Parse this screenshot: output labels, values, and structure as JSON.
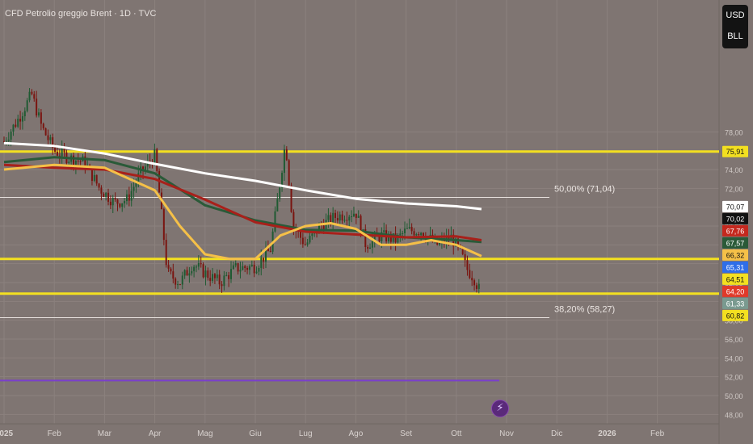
{
  "header": {
    "symbol_title": "CFD Petrolio greggio Brent · 1D · TVC"
  },
  "currency": {
    "top": "USD",
    "bottom": "BLL"
  },
  "event_icon": "lightning-icon",
  "chart_data": {
    "type": "candlestick",
    "title": "CFD Petrolio greggio Brent · 1D · TVC",
    "ylim": [
      47,
      92
    ],
    "y_ticks": [
      "48,00",
      "50,00",
      "52,00",
      "54,00",
      "56,00",
      "58,00",
      "60,00",
      "62,00",
      "64,00",
      "66,00",
      "68,00",
      "70,00",
      "72,00",
      "74,00",
      "76,00",
      "78,00"
    ],
    "x_labels": [
      "2025",
      "Feb",
      "Mar",
      "Apr",
      "Mag",
      "Giu",
      "Lug",
      "Ago",
      "Set",
      "Ott",
      "Nov",
      "Dic",
      "2026",
      "Feb"
    ],
    "x_months": [
      0,
      1,
      2,
      3,
      4,
      5,
      6,
      7,
      8,
      9,
      10,
      11,
      12,
      13
    ],
    "close_path": [
      [
        0,
        77
      ],
      [
        0.3,
        79.5
      ],
      [
        0.55,
        82
      ],
      [
        0.75,
        78.5
      ],
      [
        1,
        76
      ],
      [
        1.3,
        75.2
      ],
      [
        1.6,
        74.8
      ],
      [
        1.9,
        72
      ],
      [
        2.2,
        70.5
      ],
      [
        2.45,
        70.8
      ],
      [
        2.7,
        73.5
      ],
      [
        3,
        75.5
      ],
      [
        3.1,
        71
      ],
      [
        3.25,
        63
      ],
      [
        3.5,
        62
      ],
      [
        3.75,
        64
      ],
      [
        4,
        63
      ],
      [
        4.3,
        62
      ],
      [
        4.6,
        63.5
      ],
      [
        5,
        63.7
      ],
      [
        5.3,
        65.5
      ],
      [
        5.45,
        71
      ],
      [
        5.6,
        77
      ],
      [
        5.75,
        68
      ],
      [
        6,
        66
      ],
      [
        6.3,
        68
      ],
      [
        6.6,
        69
      ],
      [
        7,
        69.5
      ],
      [
        7.2,
        66
      ],
      [
        7.5,
        67
      ],
      [
        7.8,
        66.5
      ],
      [
        8,
        67.5
      ],
      [
        8.3,
        67.5
      ],
      [
        8.6,
        66
      ],
      [
        8.9,
        66.8
      ],
      [
        9.1,
        65
      ],
      [
        9.2,
        63.5
      ],
      [
        9.35,
        62.5
      ],
      [
        9.45,
        61.3
      ]
    ],
    "series": [
      {
        "color": "#ffffff",
        "points": [
          [
            0,
            76.8
          ],
          [
            1,
            76.5
          ],
          [
            2,
            75.7
          ],
          [
            3,
            74.6
          ],
          [
            4,
            73.6
          ],
          [
            5,
            72.8
          ],
          [
            6,
            71.8
          ],
          [
            7,
            70.9
          ],
          [
            8,
            70.4
          ],
          [
            9,
            70.1
          ],
          [
            9.5,
            69.8
          ]
        ]
      },
      {
        "color": "#2a5a38",
        "points": [
          [
            0,
            74.8
          ],
          [
            1,
            75.3
          ],
          [
            2,
            75
          ],
          [
            3,
            73.6
          ],
          [
            4,
            70.2
          ],
          [
            5,
            68.6
          ],
          [
            6,
            67.6
          ],
          [
            7,
            67.5
          ],
          [
            8,
            66.8
          ],
          [
            9,
            66.5
          ],
          [
            9.5,
            66.3
          ]
        ]
      },
      {
        "color": "#a8201a",
        "points": [
          [
            0,
            74.5
          ],
          [
            1,
            74.2
          ],
          [
            2,
            74
          ],
          [
            3,
            73
          ],
          [
            4,
            70.8
          ],
          [
            5,
            68.4
          ],
          [
            6,
            67.4
          ],
          [
            7,
            67.1
          ],
          [
            8,
            66.8
          ],
          [
            9,
            66.9
          ],
          [
            9.5,
            66.5
          ]
        ]
      },
      {
        "color": "#f5c048",
        "points": [
          [
            0,
            74
          ],
          [
            1,
            74.5
          ],
          [
            2,
            74.2
          ],
          [
            3,
            71.8
          ],
          [
            3.5,
            68
          ],
          [
            4,
            65
          ],
          [
            4.5,
            64.5
          ],
          [
            5,
            64.5
          ],
          [
            5.5,
            67
          ],
          [
            6,
            68
          ],
          [
            6.5,
            68.3
          ],
          [
            7,
            67.7
          ],
          [
            7.5,
            66
          ],
          [
            8,
            66
          ],
          [
            8.5,
            66.5
          ],
          [
            9,
            66
          ],
          [
            9.5,
            64.8
          ]
        ]
      }
    ],
    "horizontal_levels": [
      {
        "value": 75.91,
        "color": "#f3e020"
      },
      {
        "value": 64.51,
        "color": "#f3e020"
      },
      {
        "value": 60.82,
        "color": "#f3e020"
      },
      {
        "value": 51.6,
        "color": "#7a3fcc"
      }
    ],
    "fib_levels": [
      {
        "value": 71.04,
        "label": "50,00% (71,04)"
      },
      {
        "value": 58.27,
        "label": "38,20% (58,27)"
      }
    ],
    "price_badges": [
      {
        "value": 75.91,
        "label": "75,91",
        "bg": "#f3e020",
        "fg": "#111111"
      },
      {
        "value": 70.07,
        "label": "70,07",
        "bg": "#ffffff",
        "fg": "#111111"
      },
      {
        "value": 70.02,
        "label": "70,02",
        "bg": "#111111",
        "fg": "#ffffff"
      },
      {
        "value": 67.76,
        "label": "67,76",
        "bg": "#c4281e",
        "fg": "#ffffff"
      },
      {
        "value": 67.57,
        "label": "67,57",
        "bg": "#2a5a38",
        "fg": "#ffffff"
      },
      {
        "value": 66.32,
        "label": "66,32",
        "bg": "#f5c048",
        "fg": "#111111"
      },
      {
        "value": 65.31,
        "label": "65,31",
        "bg": "#2f6ee8",
        "fg": "#ffffff"
      },
      {
        "value": 64.51,
        "label": "64,51",
        "bg": "#f3e020",
        "fg": "#111111"
      },
      {
        "value": 64.2,
        "label": "64,20",
        "bg": "#e03a2a",
        "fg": "#ffffff"
      },
      {
        "value": 61.33,
        "label": "61,33",
        "bg": "#7a9a90",
        "fg": "#ffffff"
      },
      {
        "value": 60.82,
        "label": "60,82",
        "bg": "#f3e020",
        "fg": "#111111"
      }
    ],
    "colors": {
      "background": "#7f7572",
      "grid": "#8b817e",
      "candle_up": "#1f5a32",
      "candle_down": "#7a1510"
    }
  }
}
